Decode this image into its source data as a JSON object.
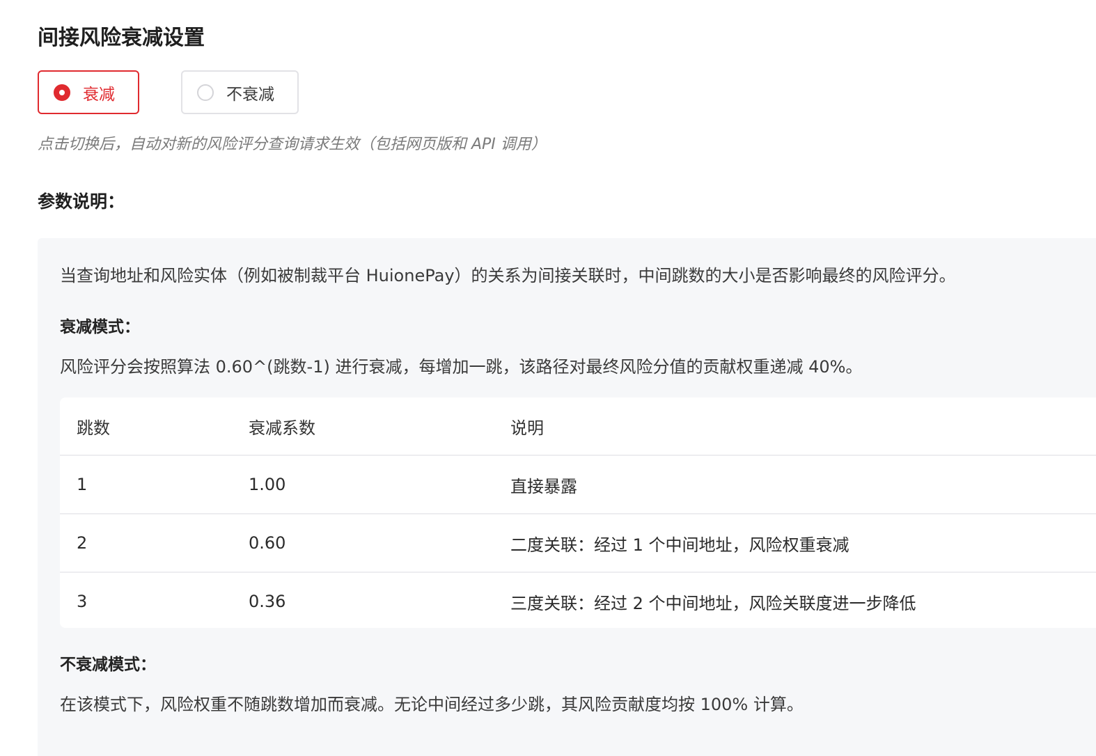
{
  "page": {
    "title": "间接风险衰减设置",
    "hint": "点击切换后，自动对新的风险评分查询请求生效（包括网页版和 API 调用）",
    "params_title": "参数说明："
  },
  "radio": {
    "options": [
      {
        "label": "衰减",
        "selected": true
      },
      {
        "label": "不衰减",
        "selected": false
      }
    ]
  },
  "colors": {
    "accent": "#e02a2f",
    "panel_bg": "#f6f7f9"
  },
  "panel": {
    "intro": "当查询地址和风险实体（例如被制裁平台 HuionePay）的关系为间接关联时，中间跳数的大小是否影响最终的风险评分。",
    "decay_mode_title": "衰减模式：",
    "decay_mode_desc": "风险评分会按照算法 0.60^(跳数-1) 进行衰减，每增加一跳，该路径对最终风险分值的贡献权重递减 40%。",
    "table": {
      "headers": [
        "跳数",
        "衰减系数",
        "说明"
      ],
      "rows": [
        [
          "1",
          "1.00",
          "直接暴露"
        ],
        [
          "2",
          "0.60",
          "二度关联：经过 1 个中间地址，风险权重衰减"
        ],
        [
          "3",
          "0.36",
          "三度关联：经过 2 个中间地址，风险关联度进一步降低"
        ]
      ]
    },
    "no_decay_mode_title": "不衰减模式：",
    "no_decay_mode_desc": "在该模式下，风险权重不随跳数增加而衰减。无论中间经过多少跳，其风险贡献度均按 100% 计算。"
  }
}
